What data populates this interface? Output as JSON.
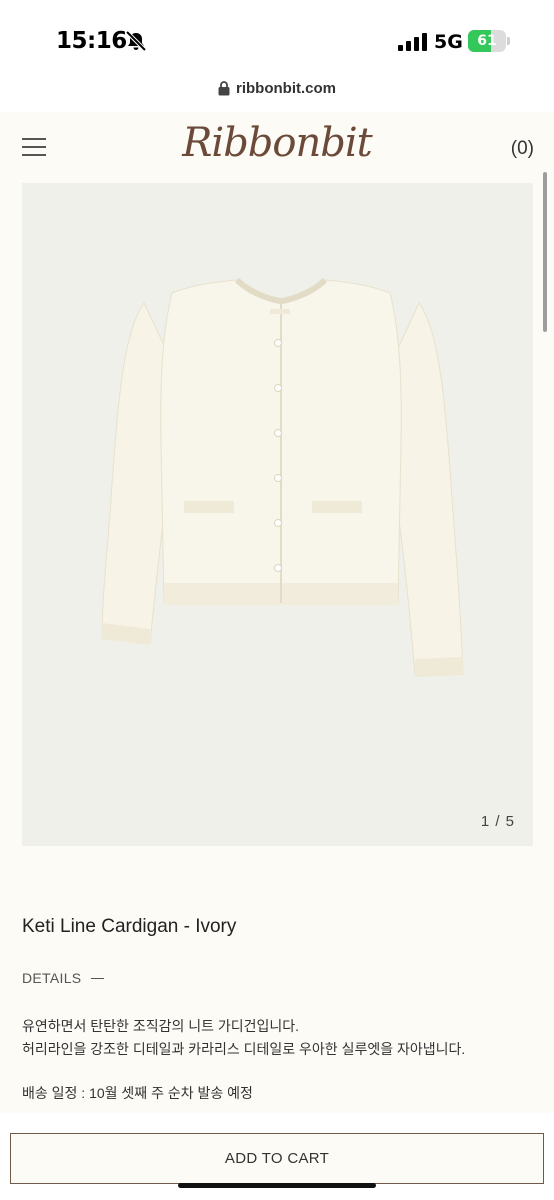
{
  "status_bar": {
    "time": "15:16",
    "network": "5G",
    "battery_level": "61",
    "battery_fraction": 0.61,
    "battery_color": "#34c759",
    "icons": [
      "bell-slash-icon",
      "signal-icon",
      "battery-icon"
    ]
  },
  "browser": {
    "url": "ribbonbit.com",
    "icons": [
      "lock-icon"
    ]
  },
  "header": {
    "logo_text": "Ribbonbit",
    "cart_count": "(0)",
    "icons": [
      "hamburger-menu-icon"
    ],
    "logo_color": "#6b4a39"
  },
  "gallery": {
    "pager": "1 / 5",
    "image": "ivory-cardigan-photo"
  },
  "product": {
    "name": "Keti Line Cardigan - Ivory",
    "details_label": "DETAILS",
    "description_line1": "유연하면서 탄탄한 조직감의 니트 가디건입니다.",
    "description_line2": "허리라인을 강조한 디테일과 카라리스 디테일로 우아한 실루엣을 자아냅니다.",
    "shipping": "배송 일정 : 10월 셋째 주 순차 발송 예정"
  },
  "cart": {
    "button_label": "ADD TO CART",
    "accent": "#6f5a4a"
  }
}
